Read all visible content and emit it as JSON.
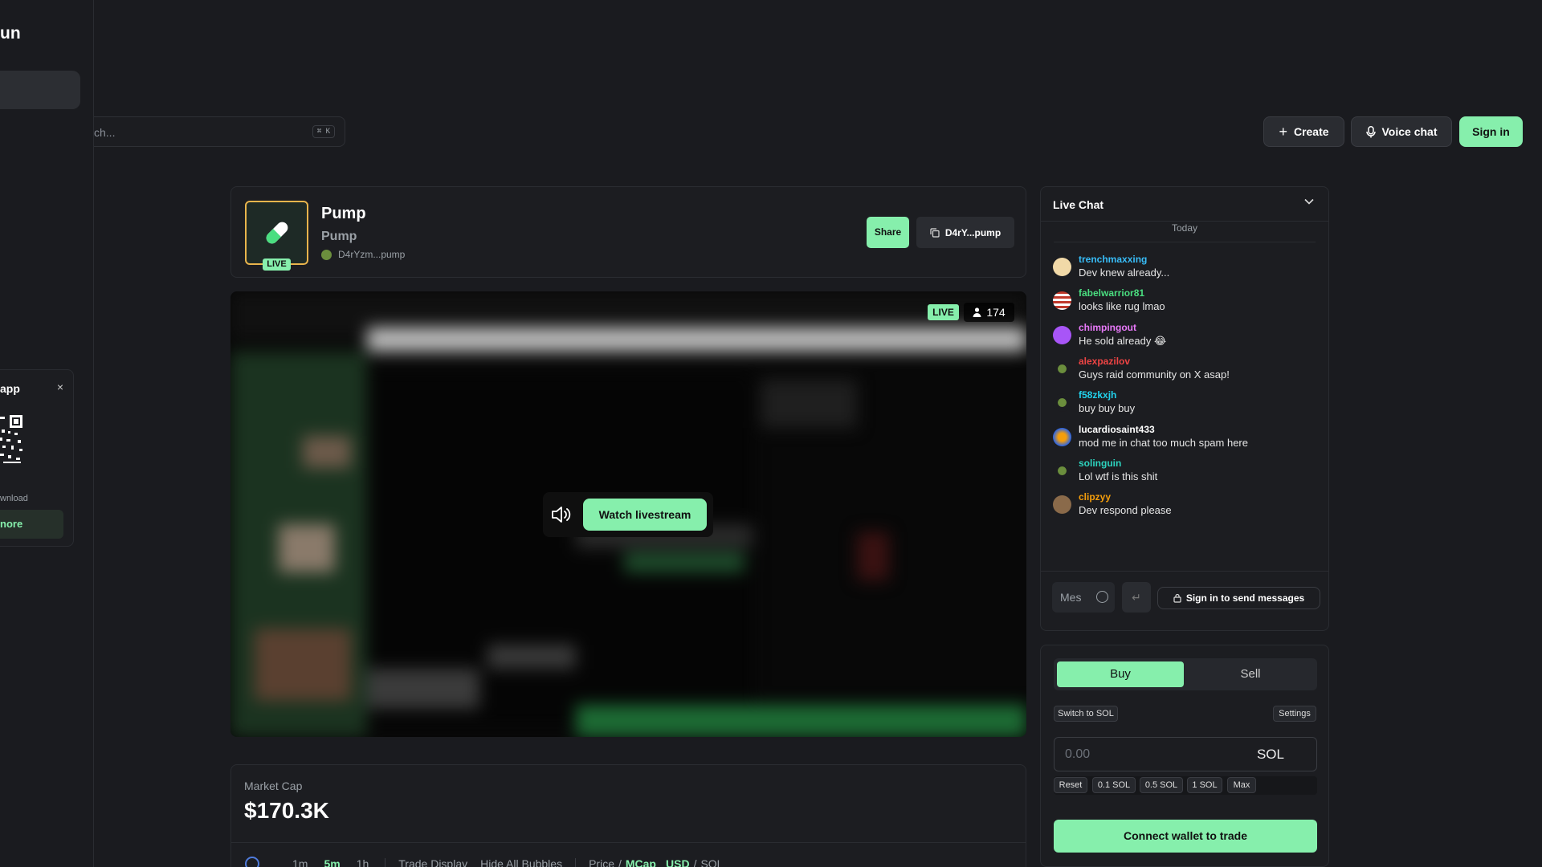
{
  "sidebar": {
    "brand": "un",
    "qr_card": {
      "title": "app",
      "close": "×",
      "subtitle": "wnload",
      "button": "nore"
    }
  },
  "search": {
    "placeholder": "ch...",
    "shortcut": "⌘ K"
  },
  "header": {
    "create": "Create",
    "voice_chat": "Voice chat",
    "sign_in": "Sign in"
  },
  "token": {
    "name": "Pump",
    "symbol": "Pump",
    "address": "D4rYzm...pump",
    "live_badge": "LIVE",
    "share": "Share",
    "copy_address": "D4rY...pump"
  },
  "stream": {
    "live": "LIVE",
    "viewers": "174",
    "watch": "Watch livestream"
  },
  "market": {
    "label": "Market Cap",
    "value": "$170.3K",
    "timeframes": [
      "1m",
      "5m",
      "1h"
    ],
    "active_timeframe": "5m",
    "trade_display": "Trade Display",
    "hide_bubbles": "Hide All Bubbles",
    "price": "Price",
    "mcap": "MCap",
    "usd": "USD",
    "sol": "SOL",
    "slash": "/"
  },
  "chat": {
    "title": "Live Chat",
    "today": "Today",
    "messages": [
      {
        "user": "trenchmaxxing",
        "text": "Dev knew already...",
        "color": "#38bdf8"
      },
      {
        "user": "fabelwarrior81",
        "text": "looks like rug lmao",
        "color": "#4ade80"
      },
      {
        "user": "chimpingout",
        "text": "He sold already 😂",
        "color": "#e879f9"
      },
      {
        "user": "alexpazilov",
        "text": "Guys raid community on X asap!",
        "color": "#ef4444"
      },
      {
        "user": "f58zkxjh",
        "text": "buy buy buy",
        "color": "#22d3ee"
      },
      {
        "user": "lucardiosaint433",
        "text": "mod me in chat too much spam here",
        "color": "#ffffff"
      },
      {
        "user": "solinguin",
        "text": "Lol wtf is this shit",
        "color": "#2dd4bf"
      },
      {
        "user": "clipzyy",
        "text": "Dev respond please",
        "color": "#f59e0b"
      }
    ],
    "input_placeholder": "Mes",
    "send_icon": "↵",
    "sign_in_to_send": "Sign in to send messages"
  },
  "trade": {
    "buy": "Buy",
    "sell": "Sell",
    "switch": "Switch to SOL",
    "settings": "Settings",
    "amount_placeholder": "0.00",
    "unit": "SOL",
    "quick": [
      "Reset",
      "0.1 SOL",
      "0.5 SOL",
      "1 SOL",
      "Max"
    ],
    "connect": "Connect wallet to trade"
  },
  "colors": {
    "accent": "#86efac",
    "background": "#1a1b1f",
    "card": "#1c1d21",
    "gold_border": "#e9b44c"
  }
}
